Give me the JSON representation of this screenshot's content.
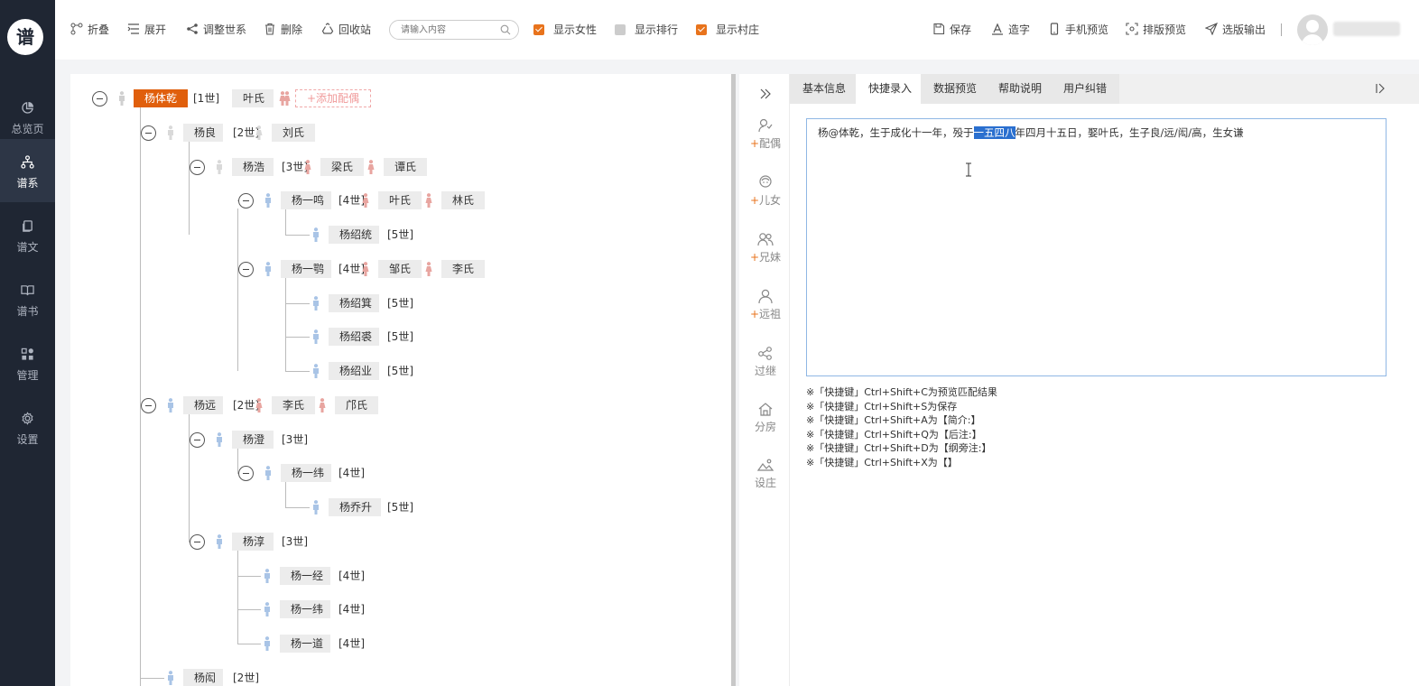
{
  "app": {
    "logo_text": "谱"
  },
  "nav": [
    {
      "label": "总览页",
      "icon": "pie-chart-icon"
    },
    {
      "label": "谱系",
      "icon": "family-tree-icon",
      "active": true
    },
    {
      "label": "谱文",
      "icon": "document-copy-icon"
    },
    {
      "label": "谱书",
      "icon": "open-book-icon"
    },
    {
      "label": "管理",
      "icon": "grid-apps-icon"
    },
    {
      "label": "设置",
      "icon": "gear-icon"
    }
  ],
  "toolbar": {
    "fold": "折叠",
    "expand": "展开",
    "adjust": "调整世系",
    "delete": "删除",
    "recycle": "回收站",
    "search_placeholder": "请输入内容",
    "show_female": "显示女性",
    "show_rank": "显示排行",
    "show_village": "显示村庄",
    "show_female_checked": true,
    "show_rank_checked": false,
    "show_village_checked": true,
    "save": "保存",
    "make_char": "造字",
    "mobile_preview": "手机预览",
    "layout_preview": "排版预览",
    "export": "选版输出"
  },
  "tree": {
    "add_spouse": "+添加配偶",
    "nodes": [
      {
        "name": "杨体乾",
        "gen": "[1世]",
        "spouses": [
          "叶氏"
        ]
      },
      {
        "name": "杨良",
        "gen": "[2世]",
        "spouses": [
          "刘氏"
        ]
      },
      {
        "name": "杨浩",
        "gen": "[3世]",
        "spouses": [
          "梁氏",
          "谭氏"
        ]
      },
      {
        "name": "杨一鸣",
        "gen": "[4世]",
        "spouses": [
          "叶氏",
          "林氏"
        ]
      },
      {
        "name": "杨绍统",
        "gen": "[5世]"
      },
      {
        "name": "杨一鹗",
        "gen": "[4世]",
        "spouses": [
          "邹氏",
          "李氏"
        ]
      },
      {
        "name": "杨绍箕",
        "gen": "[5世]"
      },
      {
        "name": "杨绍裘",
        "gen": "[5世]"
      },
      {
        "name": "杨绍业",
        "gen": "[5世]"
      },
      {
        "name": "杨远",
        "gen": "[2世]",
        "spouses": [
          "李氏",
          "邝氏"
        ]
      },
      {
        "name": "杨澄",
        "gen": "[3世]"
      },
      {
        "name": "杨一纬",
        "gen": "[4世]"
      },
      {
        "name": "杨乔升",
        "gen": "[5世]"
      },
      {
        "name": "杨淳",
        "gen": "[3世]"
      },
      {
        "name": "杨一经",
        "gen": "[4世]"
      },
      {
        "name": "杨一纬",
        "gen": "[4世]"
      },
      {
        "name": "杨一道",
        "gen": "[4世]"
      },
      {
        "name": "杨闳",
        "gen": "[2世]"
      }
    ]
  },
  "side_tools": [
    {
      "label": "配偶",
      "plus": true,
      "icon": "spouse-icon"
    },
    {
      "label": "儿女",
      "plus": true,
      "icon": "child-icon"
    },
    {
      "label": "兄妹",
      "plus": true,
      "icon": "siblings-icon"
    },
    {
      "label": "远祖",
      "plus": true,
      "icon": "ancestor-icon"
    },
    {
      "label": "过继",
      "plus": false,
      "icon": "adoption-icon"
    },
    {
      "label": "分房",
      "plus": false,
      "icon": "house-icon"
    },
    {
      "label": "设庄",
      "plus": false,
      "icon": "landscape-icon"
    }
  ],
  "tabs": [
    "基本信息",
    "快捷录入",
    "数据预览",
    "帮助说明",
    "用户纠错"
  ],
  "active_tab": "快捷录入",
  "editor": {
    "before": "杨@体乾，生于成化十一年，殁于",
    "selected": "一五四八",
    "after": "年四月十五日，娶叶氏，生子良/远/闳/高，生女谦"
  },
  "hints": [
    "※「快捷键」Ctrl+Shift+C为预览匹配结果",
    "※「快捷键」Ctrl+Shift+S为保存",
    "※「快捷键」Ctrl+Shift+A为【简介:】",
    "※「快捷键」Ctrl+Shift+Q为【后注:】",
    "※「快捷键」Ctrl+Shift+D为【纲旁注:】",
    "※「快捷键」Ctrl+Shift+X为【】"
  ],
  "colors": {
    "accent": "#e8731c",
    "root_node": "#e05f0c",
    "male": "#a9c4e6",
    "female": "#e8a5a0",
    "nav_bg": "#1f2633"
  }
}
